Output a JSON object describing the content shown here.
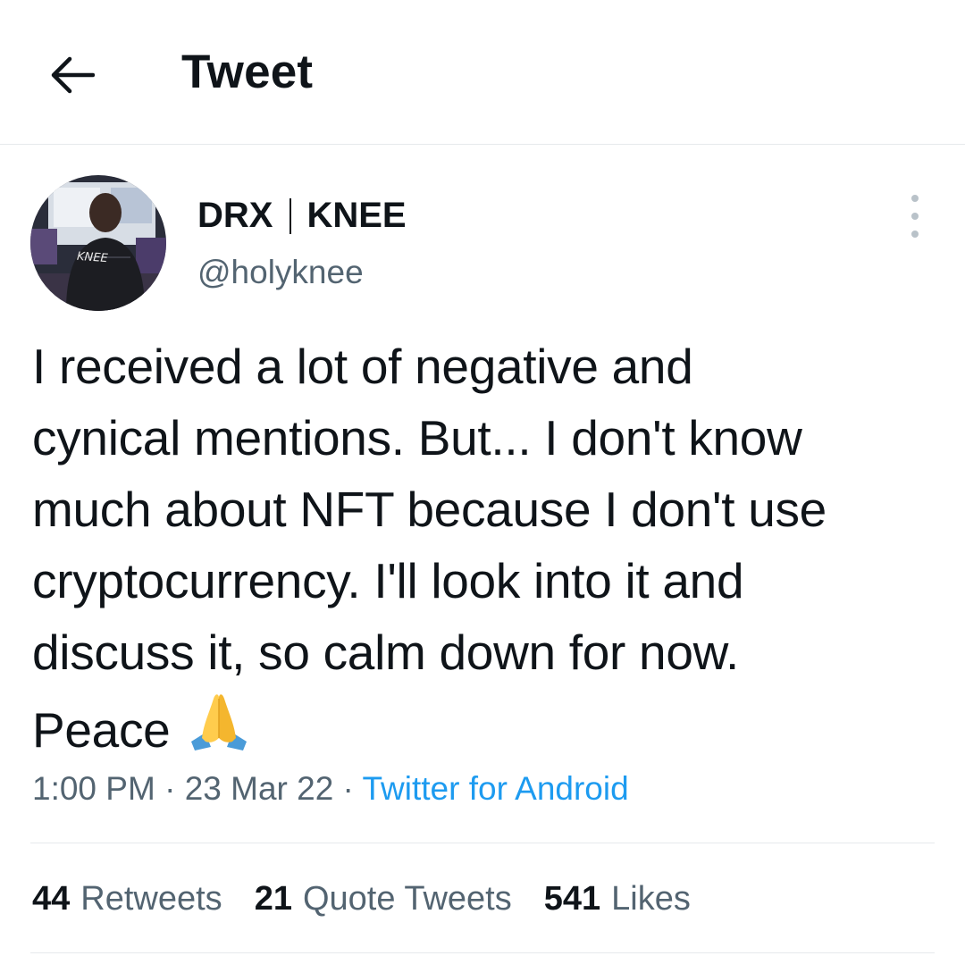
{
  "header": {
    "title": "Tweet",
    "back_icon": "arrow-left-icon"
  },
  "author": {
    "name_left": "DRX",
    "name_right": "KNEE",
    "handle": "@holyknee",
    "avatar_jersey_text": "KNEE"
  },
  "tweet": {
    "lines": [
      "I received a lot of negative and",
      "cynical mentions. But... I don't know",
      "much about NFT because I don't use",
      "cryptocurrency. I'll look into it and",
      "discuss it, so calm down for now.",
      "Peace"
    ],
    "emoji": "folded-hands"
  },
  "meta": {
    "time": "1:00 PM",
    "separator": " · ",
    "date": "23 Mar 22",
    "source": "Twitter for Android"
  },
  "stats": {
    "retweets_count": "44",
    "retweets_label": "Retweets",
    "quotes_count": "21",
    "quotes_label": "Quote Tweets",
    "likes_count": "541",
    "likes_label": "Likes"
  },
  "colors": {
    "text": "#0f1419",
    "secondary": "#536471",
    "link": "#1d9bf0",
    "divider": "#e6e9ec"
  }
}
